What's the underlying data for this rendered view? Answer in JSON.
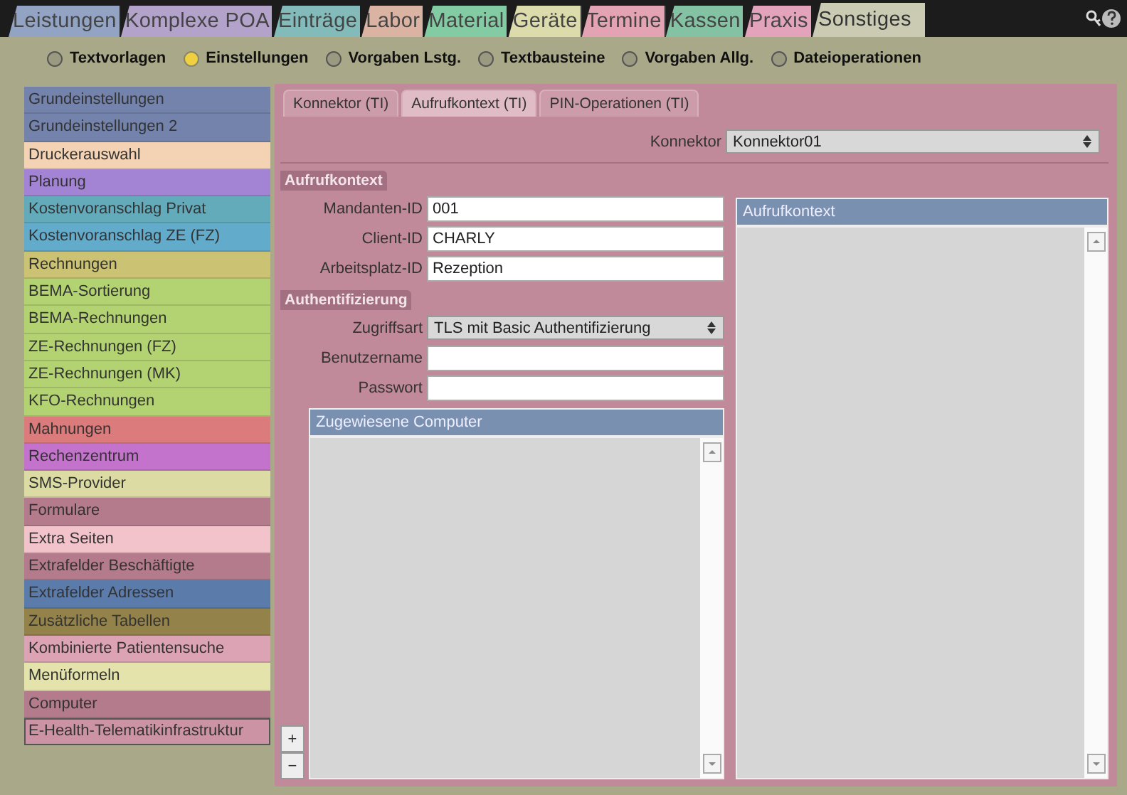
{
  "top_tabs": [
    {
      "label": "Leistungen",
      "color": "#93a3c3",
      "selected": false
    },
    {
      "label": "Komplexe POA",
      "color": "#b3a3cb",
      "selected": false
    },
    {
      "label": "Einträge",
      "color": "#83bbbb",
      "selected": false
    },
    {
      "label": "Labor",
      "color": "#dbb3a3",
      "selected": false
    },
    {
      "label": "Material",
      "color": "#83cba3",
      "selected": false
    },
    {
      "label": "Geräte",
      "color": "#dbdbab",
      "selected": false
    },
    {
      "label": "Termine",
      "color": "#e3a3b3",
      "selected": false
    },
    {
      "label": "Kassen",
      "color": "#83c3a3",
      "selected": false
    },
    {
      "label": "Praxis",
      "color": "#e3a3bb",
      "selected": false
    },
    {
      "label": "Sonstiges",
      "color": "#cbcbb3",
      "selected": true
    }
  ],
  "sub_tabs": [
    {
      "label": "Textvorlagen",
      "selected": false
    },
    {
      "label": "Einstellungen",
      "selected": true
    },
    {
      "label": "Vorgaben Lstg.",
      "selected": false
    },
    {
      "label": "Textbausteine",
      "selected": false
    },
    {
      "label": "Vorgaben Allg.",
      "selected": false
    },
    {
      "label": "Dateioperationen",
      "selected": false
    }
  ],
  "sidebar": {
    "items": [
      {
        "label": "Grundeinstellungen",
        "color": "#7383ab",
        "selected": false
      },
      {
        "label": "Grundeinstellungen 2",
        "color": "#7383ab",
        "selected": false
      },
      {
        "label": "Druckerauswahl",
        "color": "#f3d3b3",
        "selected": false
      },
      {
        "label": "Planung",
        "color": "#a383d3",
        "selected": false
      },
      {
        "label": "Kostenvoranschlag Privat",
        "color": "#63abbb",
        "selected": false
      },
      {
        "label": "Kostenvoranschlag ZE (FZ)",
        "color": "#63abcb",
        "selected": false
      },
      {
        "label": "Rechnungen",
        "color": "#cbc373",
        "selected": false
      },
      {
        "label": "BEMA-Sortierung",
        "color": "#b3d373",
        "selected": false
      },
      {
        "label": "BEMA-Rechnungen",
        "color": "#b3d373",
        "selected": false
      },
      {
        "label": "ZE-Rechnungen (FZ)",
        "color": "#b3d373",
        "selected": false
      },
      {
        "label": "ZE-Rechnungen (MK)",
        "color": "#b3d373",
        "selected": false
      },
      {
        "label": "KFO-Rechnungen",
        "color": "#b3d373",
        "selected": false
      },
      {
        "label": "Mahnungen",
        "color": "#db7b7b",
        "selected": false
      },
      {
        "label": "Rechenzentrum",
        "color": "#c373cb",
        "selected": false
      },
      {
        "label": "SMS-Provider",
        "color": "#dbdba3",
        "selected": false
      },
      {
        "label": "Formulare",
        "color": "#b37b8b",
        "selected": false
      },
      {
        "label": "Extra Seiten",
        "color": "#f3c3cb",
        "selected": false
      },
      {
        "label": "Extrafelder Beschäftigte",
        "color": "#b37b8b",
        "selected": false
      },
      {
        "label": "Extrafelder Adressen",
        "color": "#5b7bab",
        "selected": false
      },
      {
        "label": "Zusätzliche Tabellen",
        "color": "#93834b",
        "selected": false
      },
      {
        "label": "Kombinierte Patientensuche",
        "color": "#dba3b3",
        "selected": false
      },
      {
        "label": "Menüformeln",
        "color": "#e3e3ab",
        "selected": false
      },
      {
        "label": "Computer",
        "color": "#b37b8b",
        "selected": false
      },
      {
        "label": "E-Health-Telematikinfrastruktur",
        "color": "#cb93a3",
        "selected": true
      }
    ]
  },
  "inner_tabs": [
    {
      "label": "Konnektor (TI)",
      "selected": false
    },
    {
      "label": "Aufrufkontext (TI)",
      "selected": true
    },
    {
      "label": "PIN-Operationen (TI)",
      "selected": false
    }
  ],
  "konnektor": {
    "label": "Konnektor",
    "value": "Konnektor01"
  },
  "aufrufkontext": {
    "title": "Aufrufkontext",
    "fields": [
      {
        "label": "Mandanten-ID",
        "value": "001"
      },
      {
        "label": "Client-ID",
        "value": "CHARLY"
      },
      {
        "label": "Arbeitsplatz-ID",
        "value": "Rezeption"
      }
    ]
  },
  "authentifizierung": {
    "title": "Authentifizierung",
    "zugriffsart": {
      "label": "Zugriffsart",
      "value": "TLS mit Basic Authentifizierung"
    },
    "fields": [
      {
        "label": "Benutzername"
      },
      {
        "label": "Passwort"
      }
    ]
  },
  "computers_list": {
    "header": "Zugewiesene Computer",
    "add": "+",
    "remove": "−"
  },
  "context_list": {
    "header": "Aufrufkontext"
  }
}
